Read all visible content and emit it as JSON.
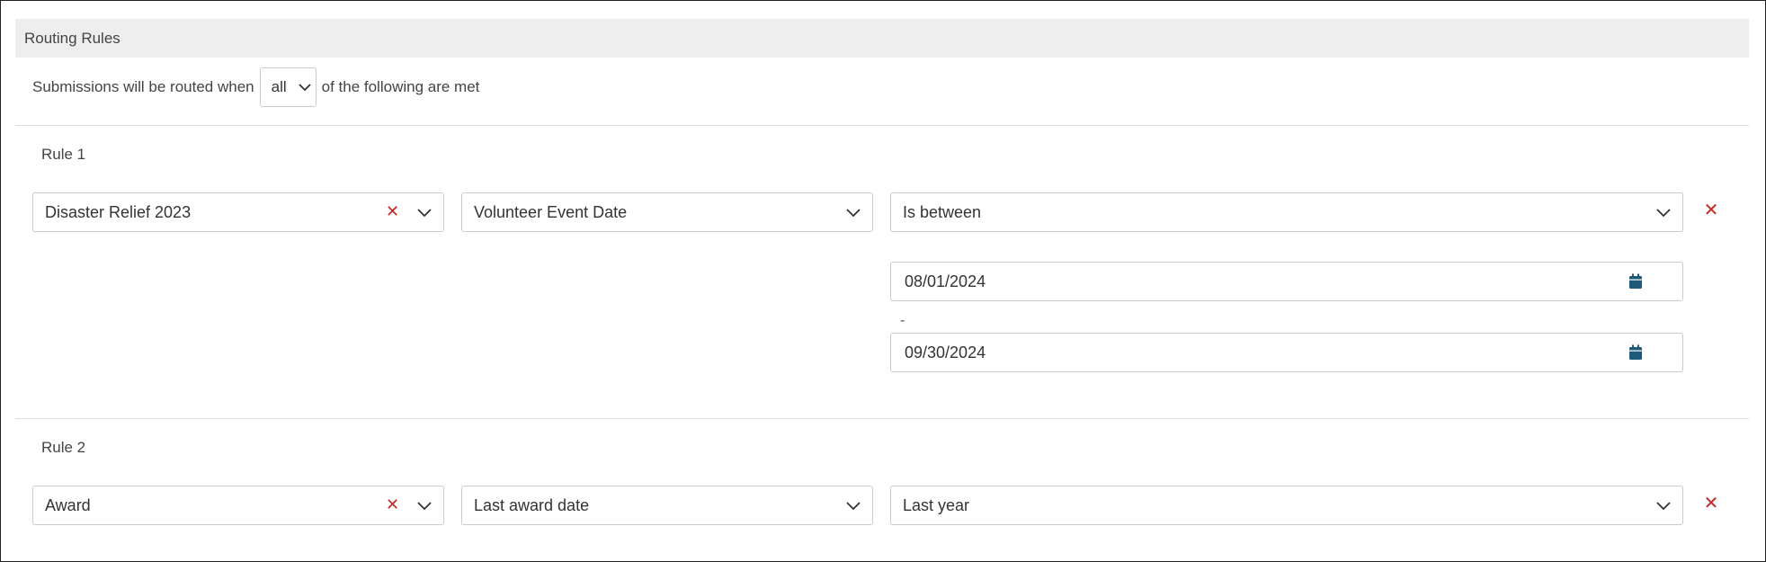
{
  "header": {
    "title": "Routing Rules"
  },
  "routing": {
    "prefix": "Submissions will be routed when",
    "match_value": "all",
    "suffix": "of the following are met"
  },
  "rules": [
    {
      "title": "Rule 1",
      "source": "Disaster Relief 2023",
      "field": "Volunteer Event Date",
      "operator": "Is between",
      "date_from": "08/01/2024",
      "range_separator": "-",
      "date_to": "09/30/2024"
    },
    {
      "title": "Rule 2",
      "source": "Award",
      "field": "Last award date",
      "operator": "Last year"
    }
  ],
  "icons": {
    "clear": "close-icon",
    "dropdown": "chevron-down-icon",
    "calendar": "calendar-icon",
    "remove": "close-icon"
  },
  "colors": {
    "header_bg": "#eeeeee",
    "border": "#cccccc",
    "remove_red": "#c62828",
    "calendar_blue": "#1f5a7a"
  }
}
